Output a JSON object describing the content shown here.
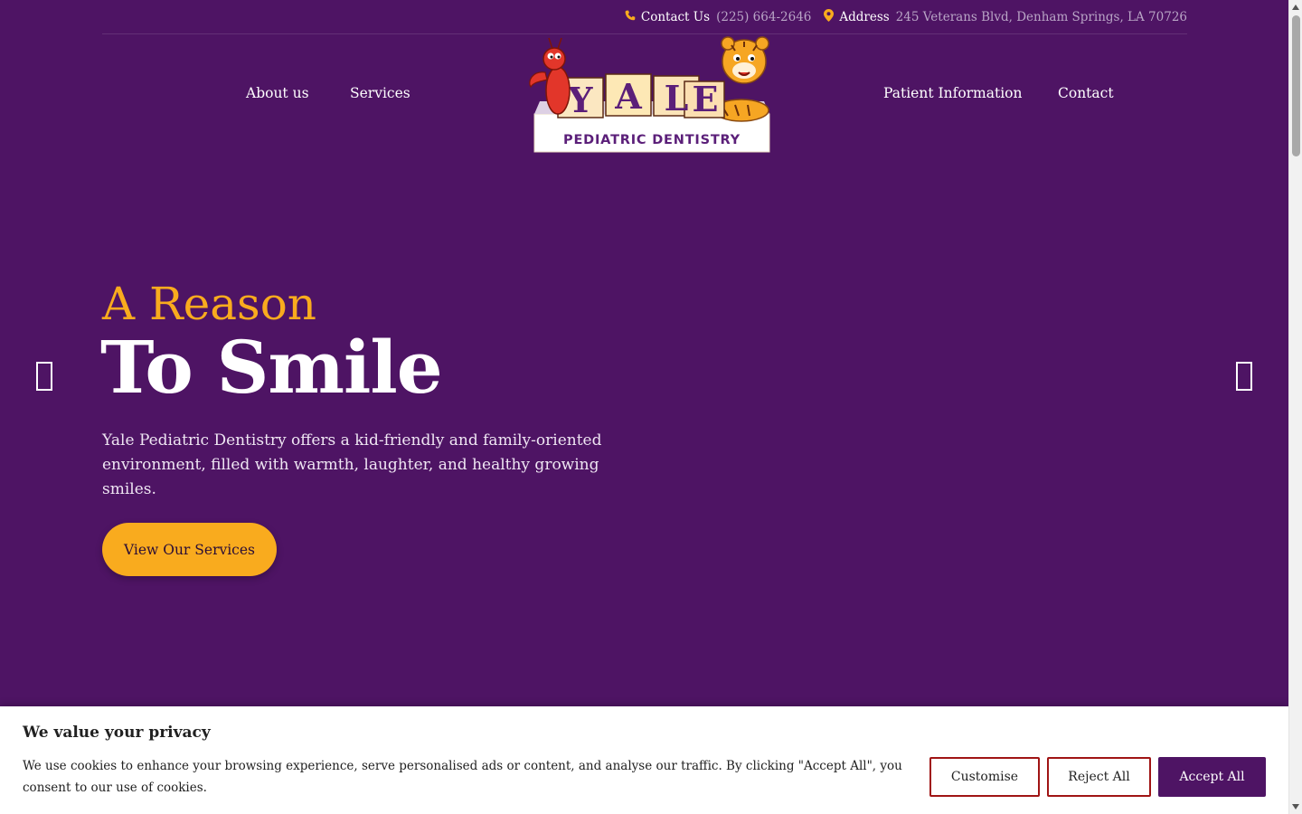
{
  "topbar": {
    "contact_label": "Contact Us",
    "contact_value": "(225) 664-2646",
    "address_label": "Address",
    "address_value": "245 Veterans Blvd, Denham Springs, LA 70726"
  },
  "nav": {
    "about": "About us",
    "services": "Services",
    "patient_info": "Patient Information",
    "contact": "Contact"
  },
  "logo": {
    "letters": [
      "Y",
      "A",
      "L",
      "E"
    ],
    "subtitle": "PEDIATRIC DENTISTRY"
  },
  "hero": {
    "subtitle": "A Reason",
    "title": "To Smile",
    "description": "Yale Pediatric Dentistry offers a kid-friendly and family-oriented environment, filled with warmth, laughter, and healthy growing smiles.",
    "button_label": "View Our Services"
  },
  "cookie": {
    "title": "We value your privacy",
    "text": "We use cookies to enhance your browsing experience, serve personalised ads or content, and analyse our traffic. By clicking \"Accept All\", you consent to our use of cookies.",
    "customise_label": "Customise",
    "reject_label": "Reject All",
    "accept_label": "Accept All"
  },
  "icons": {
    "phone": "phone-icon",
    "location": "map-pin-icon",
    "prev": "chevron-left-icon",
    "next": "chevron-right-icon"
  },
  "colors": {
    "brand_purple": "#4e1464",
    "accent_yellow": "#f9ab1e",
    "muted_text": "#b9a5c6",
    "outline_red": "#a01414"
  }
}
